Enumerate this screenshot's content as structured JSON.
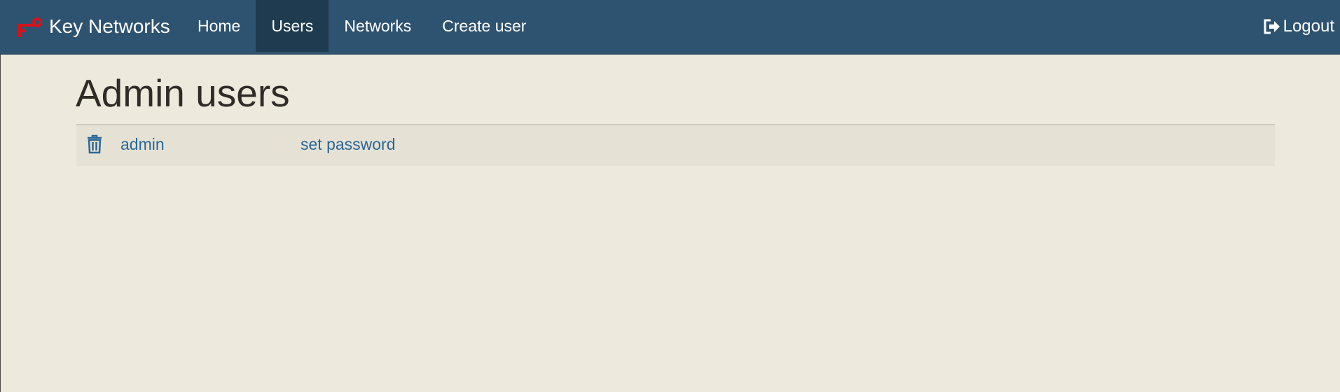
{
  "navbar": {
    "brand": "Key Networks",
    "brand_icon": "key-icon",
    "items": [
      {
        "label": "Home",
        "active": false
      },
      {
        "label": "Users",
        "active": true
      },
      {
        "label": "Networks",
        "active": false
      },
      {
        "label": "Create user",
        "active": false
      }
    ],
    "logout_label": "Logout",
    "logout_icon": "logout-icon"
  },
  "main": {
    "title": "Admin users",
    "users": [
      {
        "name": "admin",
        "action": "set password",
        "delete_icon": "trash-icon"
      }
    ]
  },
  "colors": {
    "navbar": "#2e5370",
    "navbar_active": "#1f3b50",
    "page_background": "#edeadd",
    "row_background": "#e5e2d5",
    "link": "#2b6797",
    "brand_icon": "#d8121b"
  }
}
